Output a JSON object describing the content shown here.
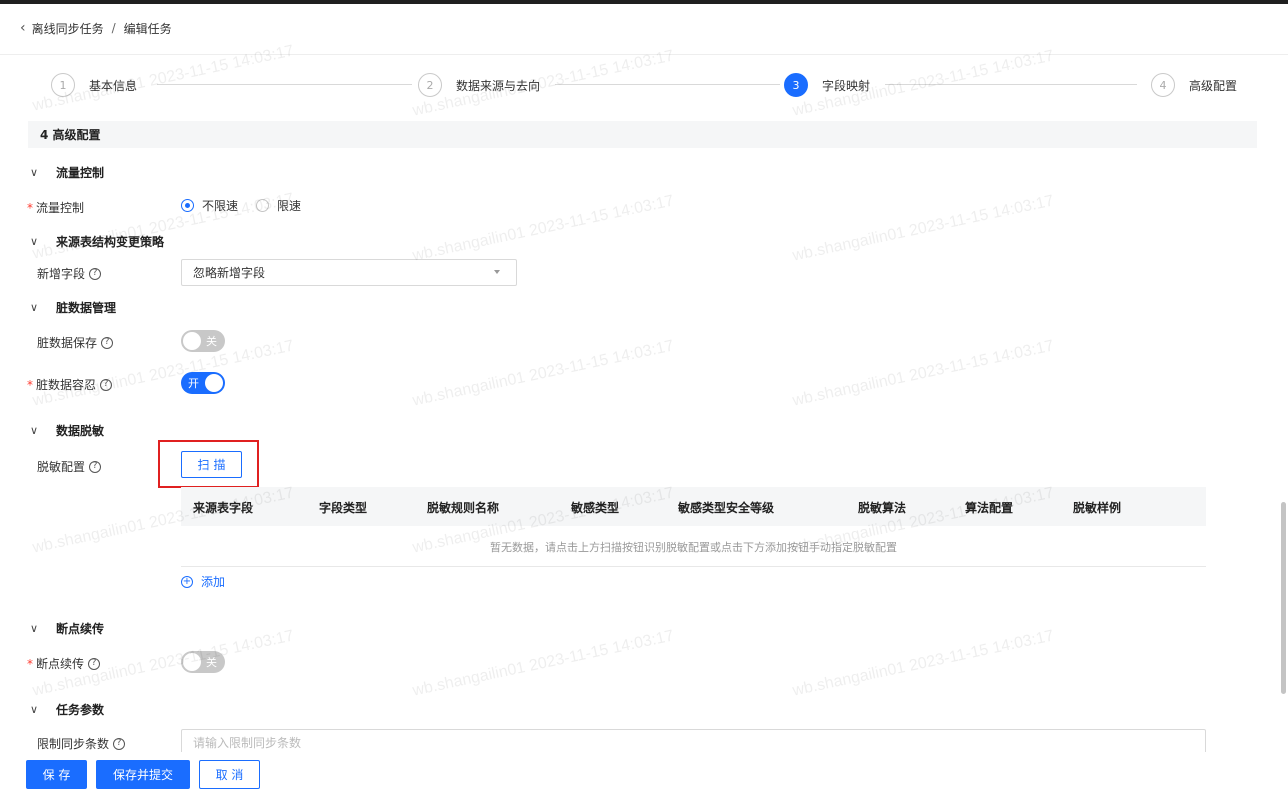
{
  "breadcrumb": {
    "back_icon": "chevron-left-icon",
    "parent": "离线同步任务",
    "separator": "/",
    "current": "编辑任务"
  },
  "steps": [
    {
      "num": "1",
      "label": "基本信息",
      "active": false
    },
    {
      "num": "2",
      "label": "数据来源与去向",
      "active": false
    },
    {
      "num": "3",
      "label": "字段映射",
      "active": true
    },
    {
      "num": "4",
      "label": "高级配置",
      "active": false
    }
  ],
  "section_header": "4 高级配置",
  "groups": {
    "flow_control": "流量控制",
    "schema_change": "来源表结构变更策略",
    "dirty_data": "脏数据管理",
    "masking": "数据脱敏",
    "resume": "断点续传",
    "task_params": "任务参数"
  },
  "fields": {
    "flow_control": {
      "label": "流量控制",
      "required": true,
      "options": [
        "不限速",
        "限速"
      ],
      "selected": "不限速"
    },
    "new_field": {
      "label": "新增字段",
      "value": "忽略新增字段"
    },
    "dirty_save": {
      "label": "脏数据保存",
      "state_text": "关",
      "on": false
    },
    "dirty_tolerance": {
      "label": "脏数据容忍",
      "required": true,
      "state_text": "开",
      "on": true
    },
    "masking_config": {
      "label": "脱敏配置",
      "scan_button": "扫描"
    },
    "resume": {
      "label": "断点续传",
      "required": true,
      "state_text": "关",
      "on": false
    },
    "limit_rows": {
      "label": "限制同步条数",
      "placeholder": "请输入限制同步条数"
    }
  },
  "masking_table": {
    "columns": [
      "来源表字段",
      "字段类型",
      "脱敏规则名称",
      "敏感类型",
      "敏感类型安全等级",
      "脱敏算法",
      "算法配置",
      "脱敏样例"
    ],
    "empty_text": "暂无数据，请点击上方扫描按钮识别脱敏配置或点击下方添加按钮手动指定脱敏配置",
    "add_label": "添加"
  },
  "footer": {
    "save": "保 存",
    "save_submit": "保存并提交",
    "cancel": "取 消"
  },
  "watermark": "wb.shangailin01 2023-11-15 14:03:17",
  "colors": {
    "primary": "#1a6dff",
    "required": "#ff3b30",
    "highlight": "#e02020"
  }
}
